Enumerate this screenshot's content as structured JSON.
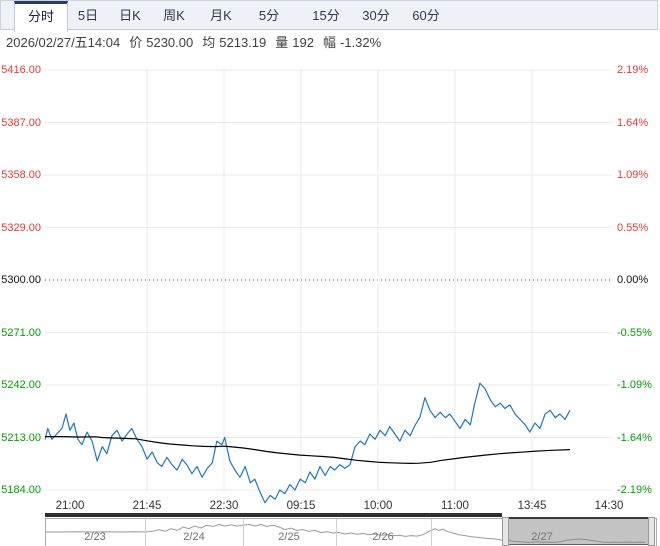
{
  "toolbar": {
    "tabs": [
      {
        "label": "分时",
        "active": true
      },
      {
        "label": "5日",
        "active": false
      },
      {
        "label": "日K",
        "active": false
      },
      {
        "label": "周K",
        "active": false
      },
      {
        "label": "月K",
        "active": false
      },
      {
        "label": "5分",
        "active": false
      },
      {
        "label": "15分",
        "active": false
      },
      {
        "label": "30分",
        "active": false
      },
      {
        "label": "60分",
        "active": false
      }
    ]
  },
  "info_bar": {
    "datetime": "2026/02/27/五14:04",
    "price_label": "价",
    "price_value": "5230.00",
    "avg_label": "均",
    "avg_value": "5213.19",
    "vol_label": "量",
    "vol_value": "192",
    "range_label": "幅",
    "range_value": "-1.32%"
  },
  "chart_data": {
    "type": "line",
    "title": "intraday time-share chart (分时)",
    "grid": true,
    "legend_position": "none",
    "ylim": [
      5184,
      5416
    ],
    "prev_close": 5300.0,
    "session_high": 5244,
    "session_low": 5177,
    "last_price": 5230.0,
    "y_axis_left": [
      {
        "label": "5416.00",
        "color": "red"
      },
      {
        "label": "5387.00",
        "color": "red"
      },
      {
        "label": "5358.00",
        "color": "red"
      },
      {
        "label": "5329.00",
        "color": "red"
      },
      {
        "label": "5300.00",
        "color": "black"
      },
      {
        "label": "5271.00",
        "color": "green"
      },
      {
        "label": "5242.00",
        "color": "green"
      },
      {
        "label": "5213.00",
        "color": "green"
      },
      {
        "label": "5184.00",
        "color": "green"
      }
    ],
    "y_axis_right": [
      {
        "label": "2.19%",
        "color": "red"
      },
      {
        "label": "1.64%",
        "color": "red"
      },
      {
        "label": "1.09%",
        "color": "red"
      },
      {
        "label": "0.55%",
        "color": "red"
      },
      {
        "label": "0.00%",
        "color": "black"
      },
      {
        "label": "-0.55%",
        "color": "green"
      },
      {
        "label": "-1.09%",
        "color": "green"
      },
      {
        "label": "-1.64%",
        "color": "green"
      },
      {
        "label": "-2.19%",
        "color": "green"
      }
    ],
    "x_ticks": [
      "21:00",
      "21:45",
      "22:30",
      "09:15",
      "10:00",
      "11:00",
      "13:45",
      "14:30"
    ],
    "series": [
      {
        "name": "price",
        "color": "#1e78bf",
        "points": [
          [
            0,
            5212
          ],
          [
            0.005,
            5218
          ],
          [
            0.012,
            5212
          ],
          [
            0.021,
            5215
          ],
          [
            0.03,
            5218
          ],
          [
            0.037,
            5226
          ],
          [
            0.044,
            5217
          ],
          [
            0.051,
            5221
          ],
          [
            0.058,
            5212
          ],
          [
            0.065,
            5209
          ],
          [
            0.074,
            5216
          ],
          [
            0.083,
            5211
          ],
          [
            0.092,
            5200
          ],
          [
            0.101,
            5208
          ],
          [
            0.109,
            5204
          ],
          [
            0.118,
            5214
          ],
          [
            0.127,
            5217
          ],
          [
            0.136,
            5211
          ],
          [
            0.145,
            5215
          ],
          [
            0.153,
            5218
          ],
          [
            0.162,
            5212
          ],
          [
            0.171,
            5208
          ],
          [
            0.18,
            5201
          ],
          [
            0.189,
            5205
          ],
          [
            0.198,
            5199
          ],
          [
            0.206,
            5197
          ],
          [
            0.215,
            5202
          ],
          [
            0.224,
            5198
          ],
          [
            0.233,
            5195
          ],
          [
            0.242,
            5201
          ],
          [
            0.25,
            5198
          ],
          [
            0.259,
            5193
          ],
          [
            0.268,
            5197
          ],
          [
            0.277,
            5191
          ],
          [
            0.286,
            5196
          ],
          [
            0.295,
            5199
          ],
          [
            0.303,
            5211
          ],
          [
            0.312,
            5209
          ],
          [
            0.317,
            5213
          ],
          [
            0.326,
            5200
          ],
          [
            0.335,
            5195
          ],
          [
            0.344,
            5191
          ],
          [
            0.353,
            5197
          ],
          [
            0.362,
            5188
          ],
          [
            0.37,
            5190
          ],
          [
            0.379,
            5183
          ],
          [
            0.388,
            5177
          ],
          [
            0.397,
            5181
          ],
          [
            0.406,
            5179
          ],
          [
            0.414,
            5184
          ],
          [
            0.423,
            5182
          ],
          [
            0.432,
            5187
          ],
          [
            0.441,
            5184
          ],
          [
            0.45,
            5190
          ],
          [
            0.459,
            5188
          ],
          [
            0.467,
            5194
          ],
          [
            0.476,
            5190
          ],
          [
            0.485,
            5197
          ],
          [
            0.494,
            5192
          ],
          [
            0.503,
            5197
          ],
          [
            0.511,
            5195
          ],
          [
            0.52,
            5198
          ],
          [
            0.529,
            5196
          ],
          [
            0.538,
            5198
          ],
          [
            0.547,
            5208
          ],
          [
            0.556,
            5211
          ],
          [
            0.564,
            5209
          ],
          [
            0.573,
            5215
          ],
          [
            0.582,
            5212
          ],
          [
            0.591,
            5217
          ],
          [
            0.6,
            5214
          ],
          [
            0.608,
            5219
          ],
          [
            0.617,
            5215
          ],
          [
            0.626,
            5211
          ],
          [
            0.635,
            5217
          ],
          [
            0.644,
            5214
          ],
          [
            0.653,
            5220
          ],
          [
            0.661,
            5224
          ],
          [
            0.67,
            5235
          ],
          [
            0.679,
            5228
          ],
          [
            0.688,
            5224
          ],
          [
            0.697,
            5227
          ],
          [
            0.706,
            5224
          ],
          [
            0.714,
            5226
          ],
          [
            0.723,
            5222
          ],
          [
            0.732,
            5218
          ],
          [
            0.741,
            5223
          ],
          [
            0.75,
            5220
          ],
          [
            0.758,
            5232
          ],
          [
            0.767,
            5243
          ],
          [
            0.776,
            5240
          ],
          [
            0.785,
            5234
          ],
          [
            0.794,
            5230
          ],
          [
            0.803,
            5232
          ],
          [
            0.811,
            5229
          ],
          [
            0.82,
            5231
          ],
          [
            0.829,
            5226
          ],
          [
            0.838,
            5223
          ],
          [
            0.847,
            5220
          ],
          [
            0.855,
            5216
          ],
          [
            0.864,
            5221
          ],
          [
            0.873,
            5218
          ],
          [
            0.882,
            5226
          ],
          [
            0.891,
            5228
          ],
          [
            0.9,
            5224
          ],
          [
            0.908,
            5226
          ],
          [
            0.917,
            5223
          ],
          [
            0.926,
            5228
          ]
        ]
      },
      {
        "name": "average",
        "color": "#000000",
        "points": [
          [
            0,
            5213.5
          ],
          [
            0.03,
            5213.5
          ],
          [
            0.06,
            5213.3
          ],
          [
            0.09,
            5213.4
          ],
          [
            0.1,
            5213.0
          ],
          [
            0.12,
            5212.7
          ],
          [
            0.14,
            5212.5
          ],
          [
            0.16,
            5212.3
          ],
          [
            0.18,
            5211.2
          ],
          [
            0.2,
            5210.2
          ],
          [
            0.22,
            5209.4
          ],
          [
            0.24,
            5208.9
          ],
          [
            0.26,
            5208.4
          ],
          [
            0.28,
            5208.1
          ],
          [
            0.3,
            5208.0
          ],
          [
            0.315,
            5208.2
          ],
          [
            0.33,
            5207.8
          ],
          [
            0.35,
            5207.2
          ],
          [
            0.37,
            5206.3
          ],
          [
            0.39,
            5205.3
          ],
          [
            0.41,
            5204.5
          ],
          [
            0.43,
            5203.9
          ],
          [
            0.45,
            5203.3
          ],
          [
            0.47,
            5202.9
          ],
          [
            0.49,
            5202.5
          ],
          [
            0.51,
            5202.0
          ],
          [
            0.53,
            5201.2
          ],
          [
            0.55,
            5200.4
          ],
          [
            0.57,
            5199.8
          ],
          [
            0.59,
            5199.3
          ],
          [
            0.61,
            5199.0
          ],
          [
            0.63,
            5198.8
          ],
          [
            0.645,
            5198.7
          ],
          [
            0.66,
            5198.8
          ],
          [
            0.68,
            5199.3
          ],
          [
            0.7,
            5200.4
          ],
          [
            0.72,
            5201.2
          ],
          [
            0.74,
            5202.0
          ],
          [
            0.76,
            5202.7
          ],
          [
            0.78,
            5203.4
          ],
          [
            0.8,
            5204.0
          ],
          [
            0.82,
            5204.5
          ],
          [
            0.84,
            5204.9
          ],
          [
            0.86,
            5205.3
          ],
          [
            0.88,
            5205.7
          ],
          [
            0.9,
            5206.0
          ],
          [
            0.926,
            5206.3
          ]
        ]
      }
    ],
    "navigator": {
      "dates": [
        "2/23",
        "2/24",
        "2/25",
        "2/26",
        "2/27"
      ],
      "selected_date": "2/27",
      "line_color": "#9a9a9a",
      "line": [
        [
          0,
          0.46
        ],
        [
          0.025,
          0.46
        ],
        [
          0.049,
          0.45
        ],
        [
          0.074,
          0.46
        ],
        [
          0.098,
          0.45
        ],
        [
          0.123,
          0.46
        ],
        [
          0.148,
          0.45
        ],
        [
          0.164,
          0.46
        ],
        [
          0.175,
          0.43
        ],
        [
          0.185,
          0.36
        ],
        [
          0.195,
          0.43
        ],
        [
          0.205,
          0.32
        ],
        [
          0.215,
          0.39
        ],
        [
          0.225,
          0.25
        ],
        [
          0.234,
          0.32
        ],
        [
          0.244,
          0.21
        ],
        [
          0.254,
          0.29
        ],
        [
          0.264,
          0.18
        ],
        [
          0.274,
          0.23
        ],
        [
          0.284,
          0.14
        ],
        [
          0.293,
          0.21
        ],
        [
          0.303,
          0.16
        ],
        [
          0.313,
          0.21
        ],
        [
          0.323,
          0.18
        ],
        [
          0.333,
          0.14
        ],
        [
          0.343,
          0.21
        ],
        [
          0.352,
          0.14
        ],
        [
          0.362,
          0.23
        ],
        [
          0.372,
          0.18
        ],
        [
          0.382,
          0.25
        ],
        [
          0.392,
          0.36
        ],
        [
          0.402,
          0.3
        ],
        [
          0.411,
          0.39
        ],
        [
          0.421,
          0.36
        ],
        [
          0.431,
          0.43
        ],
        [
          0.441,
          0.39
        ],
        [
          0.451,
          0.48
        ],
        [
          0.461,
          0.45
        ],
        [
          0.47,
          0.5
        ],
        [
          0.48,
          0.48
        ],
        [
          0.49,
          0.54
        ],
        [
          0.5,
          0.5
        ],
        [
          0.51,
          0.55
        ],
        [
          0.52,
          0.52
        ],
        [
          0.53,
          0.57
        ],
        [
          0.539,
          0.54
        ],
        [
          0.549,
          0.59
        ],
        [
          0.559,
          0.57
        ],
        [
          0.569,
          0.61
        ],
        [
          0.579,
          0.59
        ],
        [
          0.589,
          0.64
        ],
        [
          0.598,
          0.61
        ],
        [
          0.608,
          0.63
        ],
        [
          0.618,
          0.57
        ],
        [
          0.628,
          0.43
        ],
        [
          0.638,
          0.32
        ],
        [
          0.644,
          0.39
        ],
        [
          0.651,
          0.34
        ],
        [
          0.657,
          0.43
        ],
        [
          0.667,
          0.5
        ],
        [
          0.677,
          0.57
        ],
        [
          0.687,
          0.61
        ],
        [
          0.697,
          0.66
        ],
        [
          0.707,
          0.68
        ],
        [
          0.716,
          0.71
        ],
        [
          0.726,
          0.73
        ],
        [
          0.736,
          0.75
        ],
        [
          0.746,
          0.79
        ],
        [
          0.756,
          0.8
        ],
        [
          0.766,
          0.84
        ],
        [
          0.775,
          0.86
        ],
        [
          0.785,
          0.88
        ],
        [
          0.795,
          0.89
        ],
        [
          0.805,
          0.86
        ],
        [
          0.815,
          0.89
        ],
        [
          0.825,
          0.88
        ],
        [
          0.834,
          0.89
        ],
        [
          0.844,
          0.86
        ],
        [
          0.854,
          0.8
        ],
        [
          0.864,
          0.77
        ],
        [
          0.874,
          0.75
        ],
        [
          0.884,
          0.77
        ],
        [
          0.893,
          0.8
        ],
        [
          0.903,
          0.84
        ],
        [
          0.913,
          0.88
        ],
        [
          0.923,
          0.89
        ],
        [
          0.933,
          0.88
        ],
        [
          0.943,
          0.89
        ],
        [
          0.952,
          0.88
        ],
        [
          0.962,
          0.89
        ],
        [
          0.972,
          0.88
        ],
        [
          0.982,
          0.89
        ]
      ]
    },
    "colors": {
      "up": "#e23a3a",
      "down": "#00a000",
      "neutral": "#111111",
      "grid": "#ebebeb",
      "price_line": "#1e78bf",
      "avg_line": "#000000"
    }
  }
}
